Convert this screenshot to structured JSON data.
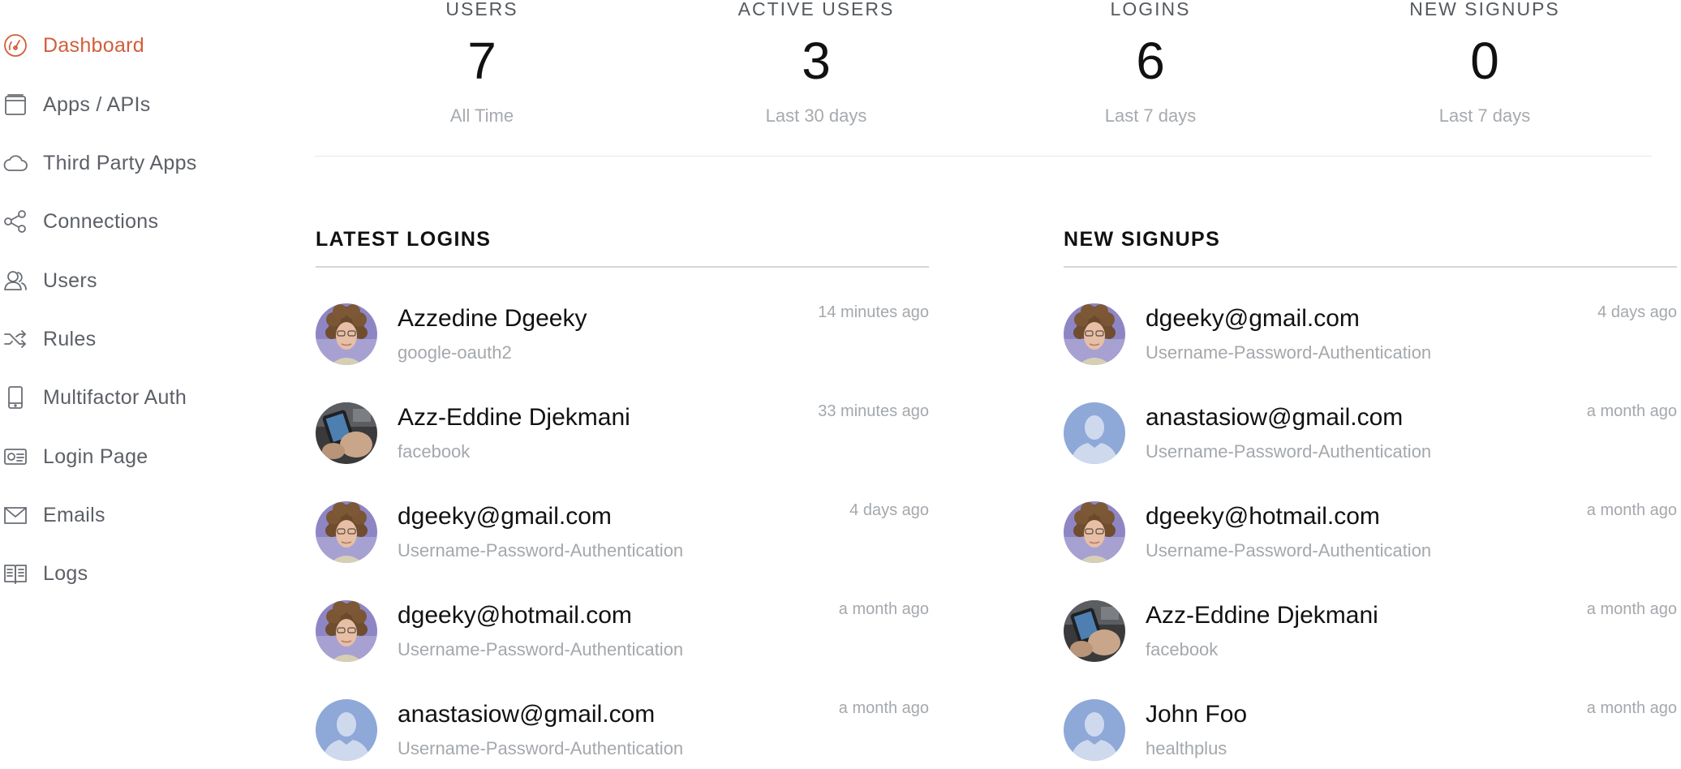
{
  "sidebar": {
    "items": [
      {
        "label": "Dashboard",
        "icon": "dashboard-gauge-icon",
        "active": true
      },
      {
        "label": "Apps / APIs",
        "icon": "apps-window-icon"
      },
      {
        "label": "Third Party Apps",
        "icon": "cloud-icon"
      },
      {
        "label": "Connections",
        "icon": "share-nodes-icon"
      },
      {
        "label": "Users",
        "icon": "users-icon"
      },
      {
        "label": "Rules",
        "icon": "shuffle-icon"
      },
      {
        "label": "Multifactor Auth",
        "icon": "phone-icon"
      },
      {
        "label": "Login Page",
        "icon": "id-card-icon"
      },
      {
        "label": "Emails",
        "icon": "envelope-icon"
      },
      {
        "label": "Logs",
        "icon": "book-icon"
      }
    ],
    "accent_color": "#d35d3b"
  },
  "stats": [
    {
      "label": "USERS",
      "value": "7",
      "sub": "All Time"
    },
    {
      "label": "ACTIVE USERS",
      "value": "3",
      "sub": "Last 30 days"
    },
    {
      "label": "LOGINS",
      "value": "6",
      "sub": "Last 7 days"
    },
    {
      "label": "NEW SIGNUPS",
      "value": "0",
      "sub": "Last 7 days"
    }
  ],
  "latest_logins": {
    "title": "LATEST LOGINS",
    "rows": [
      {
        "name": "Azzedine Dgeeky",
        "connection": "google-oauth2",
        "time": "14 minutes ago",
        "avatar": "photo-curly-hair"
      },
      {
        "name": "Azz-Eddine Djekmani",
        "connection": "facebook",
        "time": "33 minutes ago",
        "avatar": "photo-device"
      },
      {
        "name": "dgeeky@gmail.com",
        "connection": "Username-Password-Authentication",
        "time": "4 days ago",
        "avatar": "photo-curly-hair"
      },
      {
        "name": "dgeeky@hotmail.com",
        "connection": "Username-Password-Authentication",
        "time": "a month ago",
        "avatar": "photo-curly-hair"
      },
      {
        "name": "anastasiow@gmail.com",
        "connection": "Username-Password-Authentication",
        "time": "a month ago",
        "avatar": "default-silhouette"
      }
    ]
  },
  "new_signups": {
    "title": "NEW SIGNUPS",
    "rows": [
      {
        "name": "dgeeky@gmail.com",
        "connection": "Username-Password-Authentication",
        "time": "4 days ago",
        "avatar": "photo-curly-hair"
      },
      {
        "name": "anastasiow@gmail.com",
        "connection": "Username-Password-Authentication",
        "time": "a month ago",
        "avatar": "default-silhouette"
      },
      {
        "name": "dgeeky@hotmail.com",
        "connection": "Username-Password-Authentication",
        "time": "a month ago",
        "avatar": "photo-curly-hair"
      },
      {
        "name": "Azz-Eddine Djekmani",
        "connection": "facebook",
        "time": "a month ago",
        "avatar": "photo-device"
      },
      {
        "name": "John Foo",
        "connection": "healthplus",
        "time": "a month ago",
        "avatar": "default-silhouette"
      }
    ]
  }
}
